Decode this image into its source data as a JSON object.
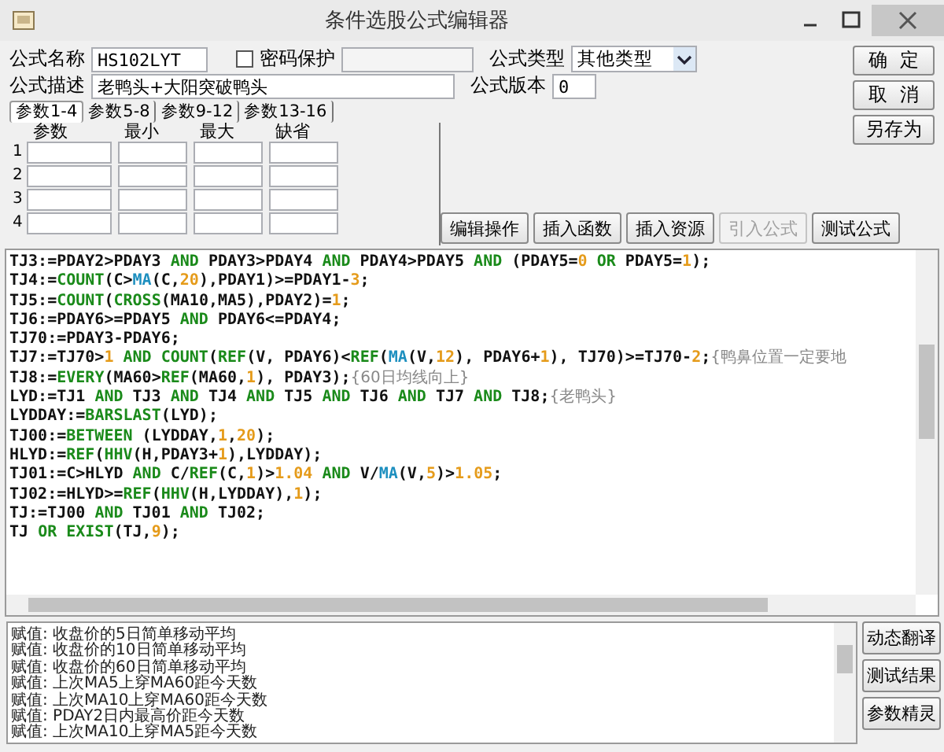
{
  "window": {
    "title": "条件选股公式编辑器"
  },
  "form": {
    "name_label": "公式名称",
    "name_value": "HS102LYT",
    "password": {
      "label": "密码保护",
      "checked": false
    },
    "type_label": "公式类型",
    "type_value": "其他类型",
    "description_label": "公式描述",
    "description_value": "老鸭头+大阳突破鸭头",
    "version_label": "公式版本",
    "version_value": "0"
  },
  "side_buttons": [
    {
      "label": "确  定"
    },
    {
      "label": "取  消"
    },
    {
      "label": "另存为"
    }
  ],
  "param_tabs": [
    {
      "label": "参数1-4",
      "selected": true
    },
    {
      "label": "参数5-8",
      "selected": false
    },
    {
      "label": "参数9-12",
      "selected": false
    },
    {
      "label": "参数13-16",
      "selected": false
    }
  ],
  "param_grid": {
    "columns": [
      "参数",
      "最小",
      "最大",
      "缺省"
    ],
    "rows": [
      "1",
      "2",
      "3",
      "4"
    ]
  },
  "tool_buttons": [
    {
      "label": "编辑操作",
      "disabled": false
    },
    {
      "label": "插入函数",
      "disabled": false
    },
    {
      "label": "插入资源",
      "disabled": false
    },
    {
      "label": "引入公式",
      "disabled": true
    },
    {
      "label": "测试公式",
      "disabled": false
    }
  ],
  "code_lines": [
    [
      {
        "text": "TJ3:=PDAY2>PDAY3 ",
        "kind": "code"
      },
      {
        "text": "AND",
        "kind": "keyword"
      },
      {
        "text": " PDAY3>PDAY4 ",
        "kind": "code"
      },
      {
        "text": "AND",
        "kind": "keyword"
      },
      {
        "text": " PDAY4>PDAY5 ",
        "kind": "code"
      },
      {
        "text": "AND",
        "kind": "keyword"
      },
      {
        "text": " (PDAY5=",
        "kind": "code"
      },
      {
        "text": "0",
        "kind": "number"
      },
      {
        "text": " OR",
        "kind": "keyword"
      },
      {
        "text": " PDAY5=",
        "kind": "code"
      },
      {
        "text": "1",
        "kind": "number"
      },
      {
        "text": ");",
        "kind": "code"
      }
    ],
    [
      {
        "text": "TJ4:=",
        "kind": "code"
      },
      {
        "text": "COUNT",
        "kind": "keyword"
      },
      {
        "text": "(C>",
        "kind": "code"
      },
      {
        "text": "MA",
        "kind": "indicator"
      },
      {
        "text": "(C,",
        "kind": "code"
      },
      {
        "text": "20",
        "kind": "number"
      },
      {
        "text": "),PDAY1)>=PDAY1-",
        "kind": "code"
      },
      {
        "text": "3",
        "kind": "number"
      },
      {
        "text": ";",
        "kind": "code"
      }
    ],
    [
      {
        "text": "TJ5:=",
        "kind": "code"
      },
      {
        "text": "COUNT",
        "kind": "keyword"
      },
      {
        "text": "(",
        "kind": "code"
      },
      {
        "text": "CROSS",
        "kind": "keyword"
      },
      {
        "text": "(MA10,MA5),PDAY2)=",
        "kind": "code"
      },
      {
        "text": "1",
        "kind": "number"
      },
      {
        "text": ";",
        "kind": "code"
      }
    ],
    [
      {
        "text": "TJ6:=PDAY6>=PDAY5 ",
        "kind": "code"
      },
      {
        "text": "AND",
        "kind": "keyword"
      },
      {
        "text": " PDAY6<=PDAY4;",
        "kind": "code"
      }
    ],
    [
      {
        "text": "TJ70:=PDAY3-PDAY6;",
        "kind": "code"
      }
    ],
    [
      {
        "text": "TJ7:=TJ70>",
        "kind": "code"
      },
      {
        "text": "1",
        "kind": "number"
      },
      {
        "text": " AND COUNT",
        "kind": "keyword"
      },
      {
        "text": "(",
        "kind": "code"
      },
      {
        "text": "REF",
        "kind": "keyword"
      },
      {
        "text": "(V, PDAY6)<",
        "kind": "code"
      },
      {
        "text": "REF",
        "kind": "keyword"
      },
      {
        "text": "(",
        "kind": "code"
      },
      {
        "text": "MA",
        "kind": "indicator"
      },
      {
        "text": "(V,",
        "kind": "code"
      },
      {
        "text": "12",
        "kind": "number"
      },
      {
        "text": "), PDAY6+",
        "kind": "code"
      },
      {
        "text": "1",
        "kind": "number"
      },
      {
        "text": "), TJ70)>=TJ70-",
        "kind": "code"
      },
      {
        "text": "2",
        "kind": "number"
      },
      {
        "text": ";",
        "kind": "code"
      },
      {
        "text": "{鸭鼻位置一定要地",
        "kind": "comment"
      }
    ],
    [
      {
        "text": "TJ8:=",
        "kind": "code"
      },
      {
        "text": "EVERY",
        "kind": "keyword"
      },
      {
        "text": "(MA60>",
        "kind": "code"
      },
      {
        "text": "REF",
        "kind": "keyword"
      },
      {
        "text": "(MA60,",
        "kind": "code"
      },
      {
        "text": "1",
        "kind": "number"
      },
      {
        "text": "), PDAY3);",
        "kind": "code"
      },
      {
        "text": "{60日均线向上}",
        "kind": "comment"
      }
    ],
    [
      {
        "text": "LYD:=TJ1 ",
        "kind": "code"
      },
      {
        "text": "AND",
        "kind": "keyword"
      },
      {
        "text": " TJ3 ",
        "kind": "code"
      },
      {
        "text": "AND",
        "kind": "keyword"
      },
      {
        "text": " TJ4 ",
        "kind": "code"
      },
      {
        "text": "AND",
        "kind": "keyword"
      },
      {
        "text": " TJ5 ",
        "kind": "code"
      },
      {
        "text": "AND",
        "kind": "keyword"
      },
      {
        "text": " TJ6 ",
        "kind": "code"
      },
      {
        "text": "AND",
        "kind": "keyword"
      },
      {
        "text": " TJ7 ",
        "kind": "code"
      },
      {
        "text": "AND",
        "kind": "keyword"
      },
      {
        "text": " TJ8;",
        "kind": "code"
      },
      {
        "text": "{老鸭头}",
        "kind": "comment"
      }
    ],
    [
      {
        "text": "LYDDAY:=",
        "kind": "code"
      },
      {
        "text": "BARSLAST",
        "kind": "keyword"
      },
      {
        "text": "(LYD);",
        "kind": "code"
      }
    ],
    [
      {
        "text": "TJ00:=",
        "kind": "code"
      },
      {
        "text": "BETWEEN",
        "kind": "keyword"
      },
      {
        "text": " (LYDDAY,",
        "kind": "code"
      },
      {
        "text": "1",
        "kind": "number"
      },
      {
        "text": ",",
        "kind": "code"
      },
      {
        "text": "20",
        "kind": "number"
      },
      {
        "text": ");",
        "kind": "code"
      }
    ],
    [
      {
        "text": "HLYD:=",
        "kind": "code"
      },
      {
        "text": "REF",
        "kind": "keyword"
      },
      {
        "text": "(",
        "kind": "code"
      },
      {
        "text": "HHV",
        "kind": "keyword"
      },
      {
        "text": "(H,PDAY3+",
        "kind": "code"
      },
      {
        "text": "1",
        "kind": "number"
      },
      {
        "text": "),LYDDAY);",
        "kind": "code"
      }
    ],
    [
      {
        "text": "TJ01:=C>HLYD ",
        "kind": "code"
      },
      {
        "text": "AND",
        "kind": "keyword"
      },
      {
        "text": " C/",
        "kind": "code"
      },
      {
        "text": "REF",
        "kind": "keyword"
      },
      {
        "text": "(C,",
        "kind": "code"
      },
      {
        "text": "1",
        "kind": "number"
      },
      {
        "text": ")>",
        "kind": "code"
      },
      {
        "text": "1.04",
        "kind": "number"
      },
      {
        "text": " AND",
        "kind": "keyword"
      },
      {
        "text": " V/",
        "kind": "code"
      },
      {
        "text": "MA",
        "kind": "indicator"
      },
      {
        "text": "(V,",
        "kind": "code"
      },
      {
        "text": "5",
        "kind": "number"
      },
      {
        "text": ")>",
        "kind": "code"
      },
      {
        "text": "1.05",
        "kind": "number"
      },
      {
        "text": ";",
        "kind": "code"
      }
    ],
    [
      {
        "text": "TJ02:=HLYD>=",
        "kind": "code"
      },
      {
        "text": "REF",
        "kind": "keyword"
      },
      {
        "text": "(",
        "kind": "code"
      },
      {
        "text": "HHV",
        "kind": "keyword"
      },
      {
        "text": "(H,LYDDAY),",
        "kind": "code"
      },
      {
        "text": "1",
        "kind": "number"
      },
      {
        "text": ");",
        "kind": "code"
      }
    ],
    [
      {
        "text": "TJ:=TJ00 ",
        "kind": "code"
      },
      {
        "text": "AND",
        "kind": "keyword"
      },
      {
        "text": " TJ01 ",
        "kind": "code"
      },
      {
        "text": "AND",
        "kind": "keyword"
      },
      {
        "text": " TJ02;",
        "kind": "code"
      }
    ],
    [
      {
        "text": "TJ ",
        "kind": "code"
      },
      {
        "text": "OR EXIST",
        "kind": "keyword"
      },
      {
        "text": "(TJ,",
        "kind": "code"
      },
      {
        "text": "9",
        "kind": "number"
      },
      {
        "text": ");",
        "kind": "code"
      }
    ]
  ],
  "messages": [
    "赋值: 收盘价的5日简单移动平均",
    "赋值: 收盘价的10日简单移动平均",
    "赋值: 收盘价的60日简单移动平均",
    "赋值: 上次MA5上穿MA60距今天数",
    "赋值: 上次MA10上穿MA60距今天数",
    "赋值: PDAY2日内最高价距今天数",
    "赋值: 上次MA10上穿MA5距今天数"
  ],
  "output_buttons": [
    {
      "label": "动态翻译"
    },
    {
      "label": "测试结果"
    },
    {
      "label": "参数精灵"
    }
  ]
}
